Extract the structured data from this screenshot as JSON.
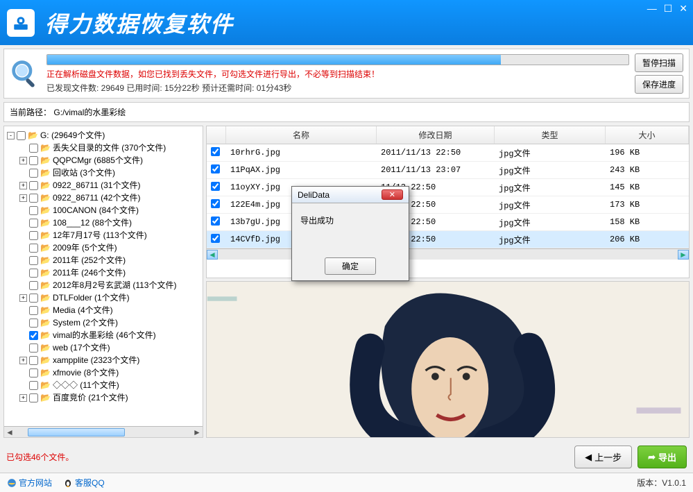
{
  "app_title": "得力数据恢复软件",
  "scan": {
    "tip": "正在解析磁盘文件数据，如您已找到丢失文件，可勾选文件进行导出，不必等到扫描结束！",
    "stats": "已发现文件数: 29649  已用时间: 15分22秒  预计还需时间: 01分43秒",
    "pause_label": "暂停扫描",
    "save_label": "保存进度"
  },
  "path": {
    "label": "当前路径：",
    "value": "G:/vimal的水墨彩绘"
  },
  "tree": [
    {
      "depth": 0,
      "exp": "-",
      "chk": false,
      "label": "G:  (29649个文件)"
    },
    {
      "depth": 1,
      "exp": "",
      "chk": false,
      "label": "丢失父目录的文件  (370个文件)"
    },
    {
      "depth": 1,
      "exp": "+",
      "chk": false,
      "label": "QQPCMgr  (6885个文件)"
    },
    {
      "depth": 1,
      "exp": "",
      "chk": false,
      "label": "回收站  (3个文件)"
    },
    {
      "depth": 1,
      "exp": "+",
      "chk": false,
      "label": "0922_86711  (31个文件)"
    },
    {
      "depth": 1,
      "exp": "+",
      "chk": false,
      "label": "0922_86711  (42个文件)"
    },
    {
      "depth": 1,
      "exp": "",
      "chk": false,
      "label": "100CANON  (84个文件)"
    },
    {
      "depth": 1,
      "exp": "",
      "chk": false,
      "label": "108___12  (88个文件)"
    },
    {
      "depth": 1,
      "exp": "",
      "chk": false,
      "label": "12年7月17号  (113个文件)"
    },
    {
      "depth": 1,
      "exp": "",
      "chk": false,
      "label": "2009年  (5个文件)"
    },
    {
      "depth": 1,
      "exp": "",
      "chk": false,
      "label": "2011年  (252个文件)"
    },
    {
      "depth": 1,
      "exp": "",
      "chk": false,
      "label": "2011年  (246个文件)"
    },
    {
      "depth": 1,
      "exp": "",
      "chk": false,
      "label": "2012年8月2号玄武湖  (113个文件)"
    },
    {
      "depth": 1,
      "exp": "+",
      "chk": false,
      "label": "DTLFolder  (1个文件)"
    },
    {
      "depth": 1,
      "exp": "",
      "chk": false,
      "label": "Media  (4个文件)"
    },
    {
      "depth": 1,
      "exp": "",
      "chk": false,
      "label": "System  (2个文件)"
    },
    {
      "depth": 1,
      "exp": "",
      "chk": true,
      "label": "vimal的水墨彩绘  (46个文件)"
    },
    {
      "depth": 1,
      "exp": "",
      "chk": false,
      "label": "web  (17个文件)"
    },
    {
      "depth": 1,
      "exp": "+",
      "chk": false,
      "label": "xampplite  (2323个文件)"
    },
    {
      "depth": 1,
      "exp": "",
      "chk": false,
      "label": "xfmovie  (8个文件)"
    },
    {
      "depth": 1,
      "exp": "",
      "chk": false,
      "label": "◇◇◇  (11个文件)"
    },
    {
      "depth": 1,
      "exp": "+",
      "chk": false,
      "label": "百度竞价  (21个文件)"
    }
  ],
  "table": {
    "headers": {
      "name": "名称",
      "date": "修改日期",
      "type": "类型",
      "size": "大小"
    },
    "rows": [
      {
        "chk": true,
        "name": "10rhrG.jpg",
        "date": "2011/11/13 22:50",
        "type": "jpg文件",
        "size": "196 KB",
        "sel": false
      },
      {
        "chk": true,
        "name": "11PqAX.jpg",
        "date": "2011/11/13 23:07",
        "type": "jpg文件",
        "size": "243 KB",
        "sel": false
      },
      {
        "chk": true,
        "name": "11oyXY.jpg",
        "date": "11/13 22:50",
        "type": "jpg文件",
        "size": "145 KB",
        "sel": false
      },
      {
        "chk": true,
        "name": "122E4m.jpg",
        "date": "11/13 22:50",
        "type": "jpg文件",
        "size": "173 KB",
        "sel": false
      },
      {
        "chk": true,
        "name": "13b7gU.jpg",
        "date": "11/13 22:50",
        "type": "jpg文件",
        "size": "158 KB",
        "sel": false
      },
      {
        "chk": true,
        "name": "14CVfD.jpg",
        "date": "11/13 22:50",
        "type": "jpg文件",
        "size": "206 KB",
        "sel": true
      }
    ]
  },
  "dialog": {
    "title": "DeliData",
    "message": "导出成功",
    "ok": "确定"
  },
  "footer": {
    "selected": "已勾选46个文件。",
    "prev": "上一步",
    "export": "导出",
    "site": "官方网站",
    "qq": "客服QQ",
    "version": "版本：V1.0.1"
  }
}
